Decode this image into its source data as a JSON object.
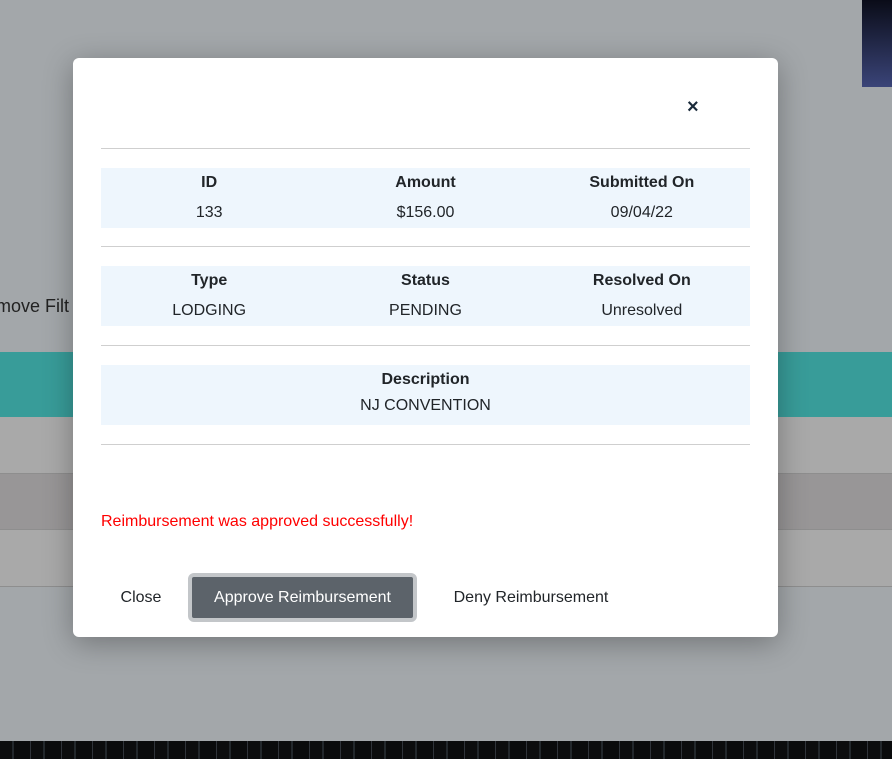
{
  "background": {
    "filter_label": "move Filt"
  },
  "modal": {
    "close_icon": "×",
    "section1": [
      {
        "label": "ID",
        "value": "133"
      },
      {
        "label": "Amount",
        "value": "$156.00"
      },
      {
        "label": "Submitted On",
        "value": "09/04/22"
      }
    ],
    "section2": [
      {
        "label": "Type",
        "value": "LODGING"
      },
      {
        "label": "Status",
        "value": "PENDING"
      },
      {
        "label": "Resolved On",
        "value": "Unresolved"
      }
    ],
    "section3": [
      {
        "label": "Description",
        "value": "NJ CONVENTION"
      }
    ],
    "message": "Reimbursement was approved successfully!",
    "message_color": "#ff0000",
    "buttons": {
      "close": "Close",
      "approve": "Approve Reimbursement",
      "deny": "Deny Reimbursement"
    }
  }
}
